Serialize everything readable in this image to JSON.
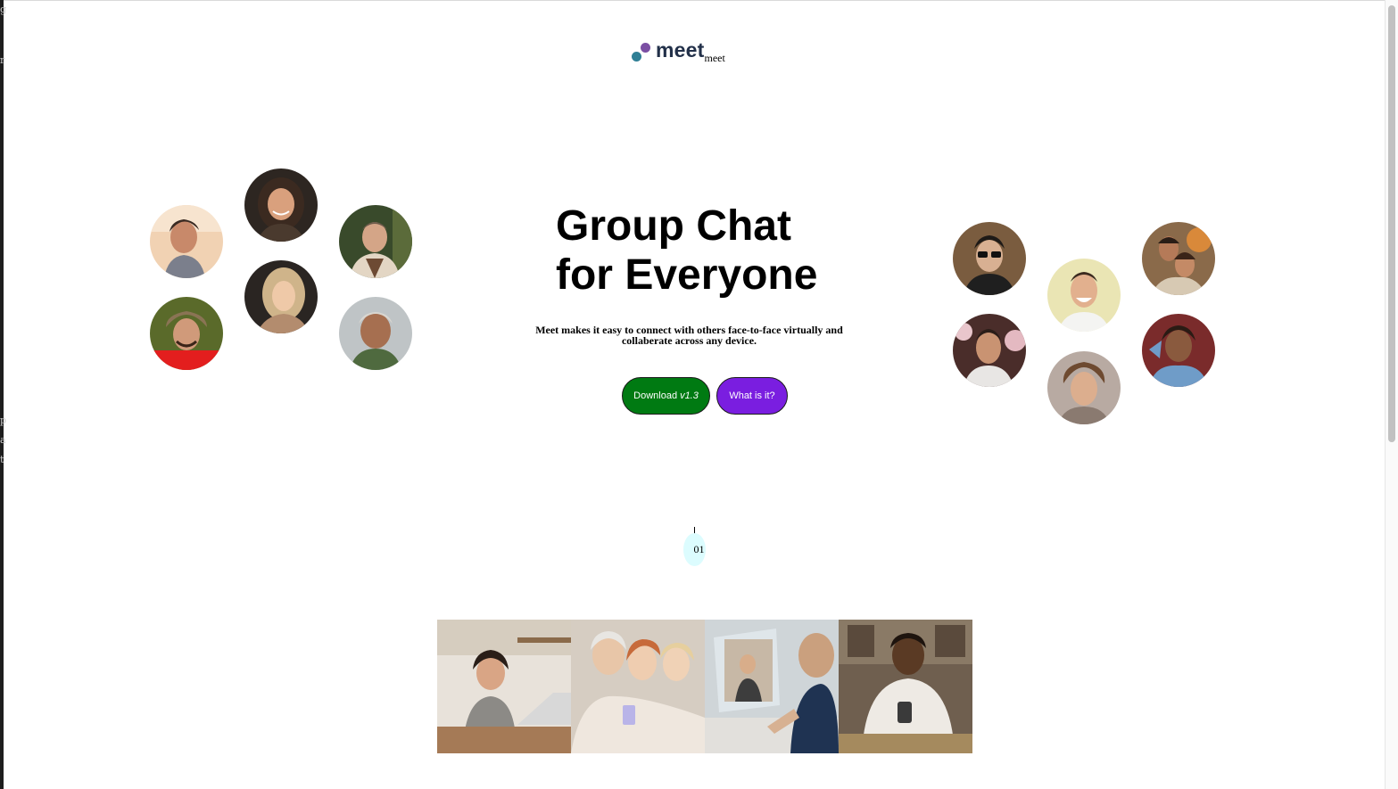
{
  "logo": {
    "word": "meet",
    "sub": "meet",
    "dot_colors": [
      "#2f7f95",
      "#7b4fa3"
    ]
  },
  "hero": {
    "title_line1": "Group Chat",
    "title_line2": "for Everyone",
    "subtitle": "Meet makes it easy to connect with others face-to-face virtually and collaberate across any device."
  },
  "buttons": {
    "download_label": "Download",
    "download_version": "v1.3",
    "what_label": "What is it?",
    "download_color": "#007a12",
    "what_color": "#7a1ee0"
  },
  "indicator": {
    "label": "01",
    "color": "#dcfcfe"
  },
  "edge_chars": [
    "g",
    "r",
    "p",
    "a",
    "t"
  ],
  "avatars": [
    {
      "name": "avatar-young-man-sunset"
    },
    {
      "name": "avatar-smiling-woman-dark-hair"
    },
    {
      "name": "avatar-man-shearling-jacket"
    },
    {
      "name": "avatar-blonde-woman"
    },
    {
      "name": "avatar-man-fur-hat"
    },
    {
      "name": "avatar-older-man-gray-hair"
    },
    {
      "name": "avatar-man-sunglasses"
    },
    {
      "name": "avatar-smiling-man-yellow-bg"
    },
    {
      "name": "avatar-couple-flowers"
    },
    {
      "name": "avatar-man-blossoms"
    },
    {
      "name": "avatar-young-man-curly-hair"
    },
    {
      "name": "avatar-woman-denim"
    }
  ],
  "photos": [
    {
      "name": "photo-woman-laptop-kitchen"
    },
    {
      "name": "photo-women-phone-together"
    },
    {
      "name": "photo-man-video-call-laptop"
    },
    {
      "name": "photo-man-phone-sofa"
    }
  ]
}
